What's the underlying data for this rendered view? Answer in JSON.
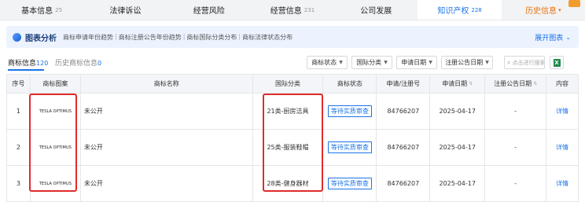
{
  "tabs": [
    {
      "label": "基本信息",
      "count": "25"
    },
    {
      "label": "法律诉讼",
      "count": ""
    },
    {
      "label": "经营风险",
      "count": ""
    },
    {
      "label": "经营信息",
      "count": "231"
    },
    {
      "label": "公司发展",
      "count": ""
    },
    {
      "label": "知识产权",
      "count": "228"
    },
    {
      "label": "历史信息",
      "count": ""
    }
  ],
  "analysis": {
    "title": "图表分析",
    "links": [
      "商标申请年份趋势",
      "商标注册公告年份趋势",
      "商标国际分类分布",
      "商标法律状态分布"
    ],
    "expand_label": "展开图表"
  },
  "subtabs": [
    {
      "label": "商标信息",
      "count": "120"
    },
    {
      "label": "历史商标信息",
      "count": "0"
    }
  ],
  "filters": [
    "商标状态",
    "国际分类",
    "申请日期",
    "注册公告日期"
  ],
  "search": {
    "placeholder": "点击进行搜索"
  },
  "table": {
    "headers": [
      "序号",
      "商标图案",
      "商标名称",
      "国际分类",
      "商标状态",
      "申请/注册号",
      "申请日期",
      "注册公告日期",
      "内容"
    ],
    "rows": [
      {
        "no": "1",
        "logo": "TESLA OPTIMUS",
        "name": "未公开",
        "class": "21类-厨房洁具",
        "status": "等待实质审查",
        "reg_no": "84766207",
        "date": "2025-04-17",
        "pub_date": "-",
        "action": "详情"
      },
      {
        "no": "2",
        "logo": "TESLA OPTIMUS",
        "name": "未公开",
        "class": "25类-服装鞋帽",
        "status": "等待实质审查",
        "reg_no": "84766207",
        "date": "2025-04-17",
        "pub_date": "-",
        "action": "详情"
      },
      {
        "no": "3",
        "logo": "TESLA OPTIMUS",
        "name": "未公开",
        "class": "28类-健身器材",
        "status": "等待实质审查",
        "reg_no": "84766207",
        "date": "2025-04-17",
        "pub_date": "-",
        "action": "详情"
      }
    ]
  },
  "colors": {
    "accent": "#1a73e8",
    "highlight": "#e02b2b",
    "history": "#e8720c"
  }
}
